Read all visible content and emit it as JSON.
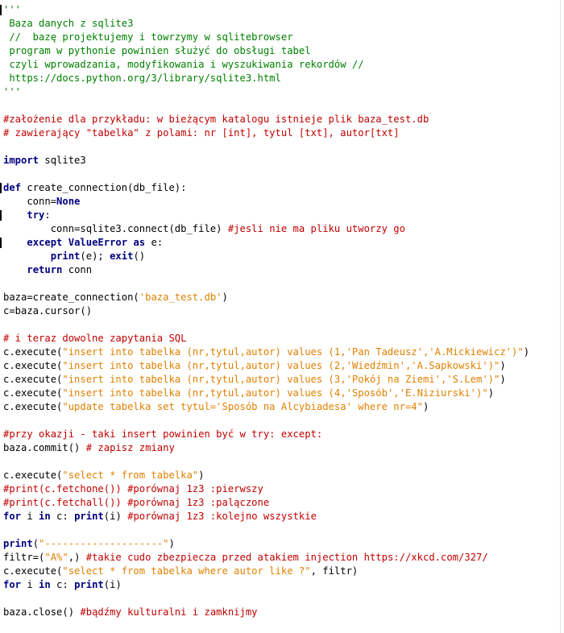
{
  "colors": {
    "keyword": "#000080",
    "comment": "#c00000",
    "string": "#e08000",
    "docstring": "#008000",
    "text": "#000000",
    "background": "#ffffff"
  },
  "lines": [
    {
      "marker": true,
      "tokens": [
        {
          "k": "docstring",
          "t": "'''"
        }
      ]
    },
    {
      "tokens": [
        {
          "k": "docstring",
          "t": " Baza danych z sqlite3"
        }
      ]
    },
    {
      "tokens": [
        {
          "k": "docstring",
          "t": " //  bazę projektujemy i towrzymy w sqlitebrowser"
        }
      ]
    },
    {
      "tokens": [
        {
          "k": "docstring",
          "t": " program w pythonie powinien służyć do obsługi tabel"
        }
      ]
    },
    {
      "tokens": [
        {
          "k": "docstring",
          "t": " czyli wprowadzania, modyfikowania i wyszukiwania rekordów //"
        }
      ]
    },
    {
      "tokens": [
        {
          "k": "docstring",
          "t": " https://docs.python.org/3/library/sqlite3.html"
        }
      ]
    },
    {
      "tokens": [
        {
          "k": "docstring",
          "t": "'''"
        }
      ]
    },
    {
      "tokens": []
    },
    {
      "tokens": [
        {
          "k": "comment",
          "t": "#założenie dla przykładu: w bieżącym katalogu istnieje plik baza_test.db"
        }
      ]
    },
    {
      "tokens": [
        {
          "k": "comment",
          "t": "# zawierający \"tabelka\" z polami: nr [int], tytul [txt], autor[txt]"
        }
      ]
    },
    {
      "tokens": []
    },
    {
      "tokens": [
        {
          "k": "keyword",
          "t": "import"
        },
        {
          "k": "text",
          "t": " sqlite3"
        }
      ]
    },
    {
      "tokens": []
    },
    {
      "marker": true,
      "tokens": [
        {
          "k": "keyword",
          "t": "def"
        },
        {
          "k": "text",
          "t": " create_connection(db_file):"
        }
      ]
    },
    {
      "tokens": [
        {
          "k": "text",
          "t": "    conn="
        },
        {
          "k": "keyword",
          "t": "None"
        }
      ]
    },
    {
      "marker": true,
      "tokens": [
        {
          "k": "text",
          "t": "    "
        },
        {
          "k": "keyword",
          "t": "try"
        },
        {
          "k": "text",
          "t": ":"
        }
      ]
    },
    {
      "tokens": [
        {
          "k": "text",
          "t": "        conn=sqlite3.connect(db_file) "
        },
        {
          "k": "comment",
          "t": "#jesli nie ma pliku utworzy go"
        }
      ]
    },
    {
      "marker": true,
      "tokens": [
        {
          "k": "text",
          "t": "    "
        },
        {
          "k": "keyword",
          "t": "except"
        },
        {
          "k": "text",
          "t": " "
        },
        {
          "k": "keyword",
          "t": "ValueError"
        },
        {
          "k": "text",
          "t": " "
        },
        {
          "k": "keyword",
          "t": "as"
        },
        {
          "k": "text",
          "t": " e:"
        }
      ]
    },
    {
      "tokens": [
        {
          "k": "text",
          "t": "        "
        },
        {
          "k": "keyword",
          "t": "print"
        },
        {
          "k": "text",
          "t": "(e); "
        },
        {
          "k": "keyword",
          "t": "exit"
        },
        {
          "k": "text",
          "t": "()"
        }
      ]
    },
    {
      "tokens": [
        {
          "k": "text",
          "t": "    "
        },
        {
          "k": "keyword",
          "t": "return"
        },
        {
          "k": "text",
          "t": " conn"
        }
      ]
    },
    {
      "tokens": []
    },
    {
      "tokens": [
        {
          "k": "text",
          "t": "baza=create_connection("
        },
        {
          "k": "string",
          "t": "'baza_test.db'"
        },
        {
          "k": "text",
          "t": ")"
        }
      ]
    },
    {
      "tokens": [
        {
          "k": "text",
          "t": "c=baza.cursor()"
        }
      ]
    },
    {
      "tokens": []
    },
    {
      "tokens": [
        {
          "k": "comment",
          "t": "# i teraz dowolne zapytania SQL"
        }
      ]
    },
    {
      "tokens": [
        {
          "k": "text",
          "t": "c.execute("
        },
        {
          "k": "string",
          "t": "\"insert into tabelka (nr,tytul,autor) values (1,'Pan Tadeusz','A.Mickiewicz')\""
        },
        {
          "k": "text",
          "t": ")"
        }
      ]
    },
    {
      "tokens": [
        {
          "k": "text",
          "t": "c.execute("
        },
        {
          "k": "string",
          "t": "\"insert into tabelka (nr,tytul,autor) values (2,'Wiedźmin','A.Sapkowski')\""
        },
        {
          "k": "text",
          "t": ")"
        }
      ]
    },
    {
      "tokens": [
        {
          "k": "text",
          "t": "c.execute("
        },
        {
          "k": "string",
          "t": "\"insert into tabelka (nr,tytul,autor) values (3,'Pokój na Ziemi','S.Lem')\""
        },
        {
          "k": "text",
          "t": ")"
        }
      ]
    },
    {
      "tokens": [
        {
          "k": "text",
          "t": "c.execute("
        },
        {
          "k": "string",
          "t": "\"insert into tabelka (nr,tytul,autor) values (4,'Sposób','E.Niziurski')\""
        },
        {
          "k": "text",
          "t": ")"
        }
      ]
    },
    {
      "tokens": [
        {
          "k": "text",
          "t": "c.execute("
        },
        {
          "k": "string",
          "t": "\"update tabelka set tytul='Sposób na Alcybiadesa' where nr=4\""
        },
        {
          "k": "text",
          "t": ")"
        }
      ]
    },
    {
      "tokens": []
    },
    {
      "tokens": [
        {
          "k": "comment",
          "t": "#przy okazji - taki insert powinien być w try: except:"
        }
      ]
    },
    {
      "tokens": [
        {
          "k": "text",
          "t": "baza.commit() "
        },
        {
          "k": "comment",
          "t": "# zapisz zmiany"
        }
      ]
    },
    {
      "tokens": []
    },
    {
      "tokens": [
        {
          "k": "text",
          "t": "c.execute("
        },
        {
          "k": "string",
          "t": "\"select * from tabelka\""
        },
        {
          "k": "text",
          "t": ")"
        }
      ]
    },
    {
      "tokens": [
        {
          "k": "comment",
          "t": "#print(c.fetchone()) #porównaj 1z3 :pierwszy"
        }
      ]
    },
    {
      "tokens": [
        {
          "k": "comment",
          "t": "#print(c.fetchall()) #porównaj 1z3 :palączone"
        }
      ]
    },
    {
      "tokens": [
        {
          "k": "keyword",
          "t": "for"
        },
        {
          "k": "text",
          "t": " i "
        },
        {
          "k": "keyword",
          "t": "in"
        },
        {
          "k": "text",
          "t": " c: "
        },
        {
          "k": "keyword",
          "t": "print"
        },
        {
          "k": "text",
          "t": "(i) "
        },
        {
          "k": "comment",
          "t": "#porównaj 1z3 :kolejno wszystkie"
        }
      ]
    },
    {
      "tokens": []
    },
    {
      "tokens": [
        {
          "k": "keyword",
          "t": "print"
        },
        {
          "k": "text",
          "t": "("
        },
        {
          "k": "string",
          "t": "\"--------------------\""
        },
        {
          "k": "text",
          "t": ")"
        }
      ]
    },
    {
      "tokens": [
        {
          "k": "text",
          "t": "filtr=("
        },
        {
          "k": "string",
          "t": "\"A%\""
        },
        {
          "k": "text",
          "t": ",) "
        },
        {
          "k": "comment",
          "t": "#takie cudo zbezpiecza przed atakiem injection https://xkcd.com/327/"
        }
      ]
    },
    {
      "tokens": [
        {
          "k": "text",
          "t": "c.execute("
        },
        {
          "k": "string",
          "t": "\"select * from tabelka where autor like ?\""
        },
        {
          "k": "text",
          "t": ", filtr)"
        }
      ]
    },
    {
      "tokens": [
        {
          "k": "keyword",
          "t": "for"
        },
        {
          "k": "text",
          "t": " i "
        },
        {
          "k": "keyword",
          "t": "in"
        },
        {
          "k": "text",
          "t": " c: "
        },
        {
          "k": "keyword",
          "t": "print"
        },
        {
          "k": "text",
          "t": "(i)"
        }
      ]
    },
    {
      "tokens": []
    },
    {
      "tokens": [
        {
          "k": "text",
          "t": "baza.close() "
        },
        {
          "k": "comment",
          "t": "#bądźmy kulturalni i zamknijmy"
        }
      ]
    }
  ]
}
